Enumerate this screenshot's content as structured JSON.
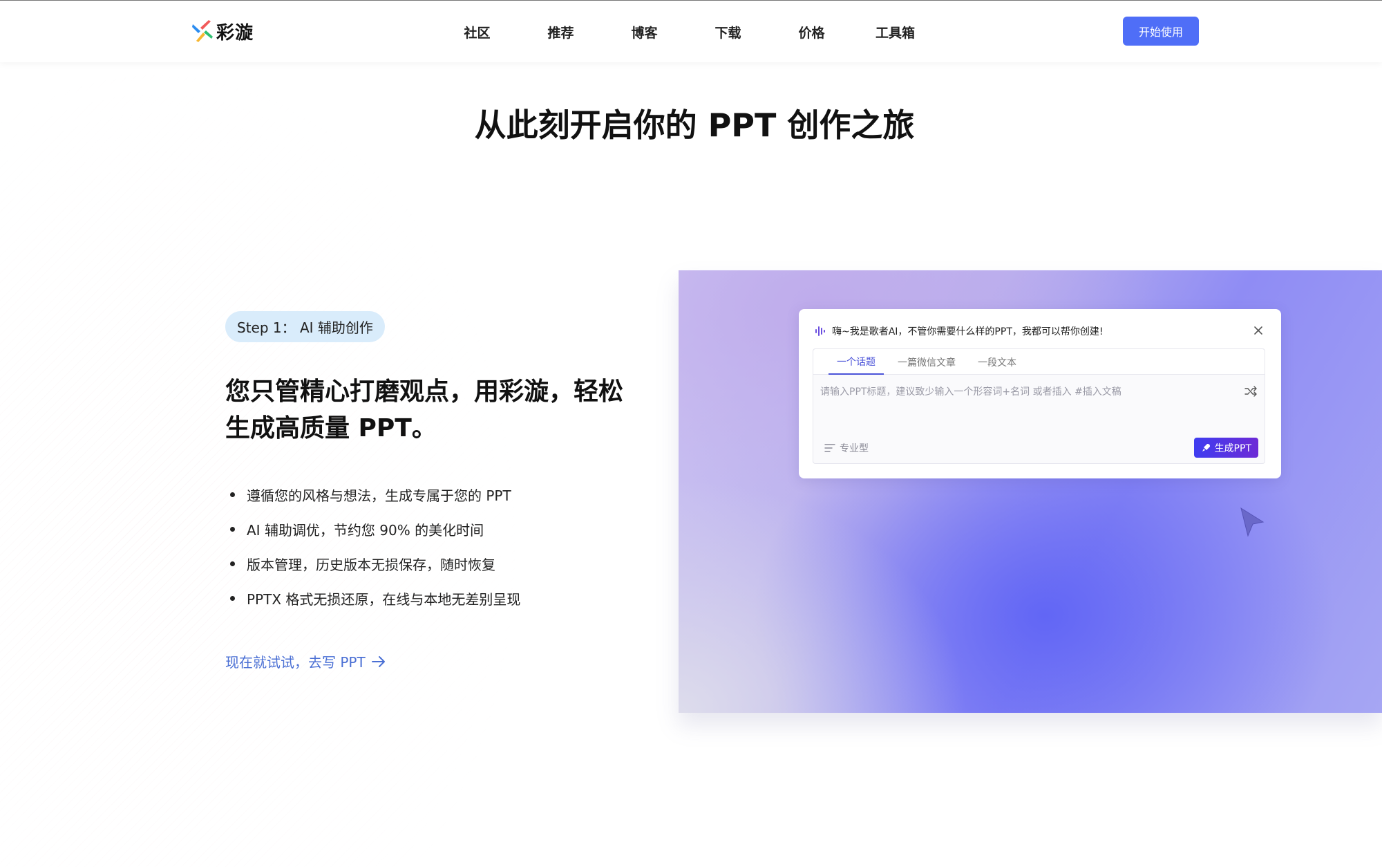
{
  "header": {
    "logo_text": "彩漩",
    "nav": [
      "社区",
      "推荐",
      "博客",
      "下载",
      "价格",
      "工具箱"
    ],
    "start_button": "开始使用"
  },
  "main": {
    "title": "从此刻开启你的 PPT 创作之旅",
    "step_badge": "Step 1： AI 辅助创作",
    "headline_line1": "您只管精心打磨观点，用彩漩，轻松",
    "headline_line2": "生成高质量 PPT。",
    "features": [
      "遵循您的风格与想法，生成专属于您的 PPT",
      "AI 辅助调优，节约您 90% 的美化时间",
      "版本管理，历史版本无损保存，随时恢复",
      "PPTX 格式无损还原，在线与本地无差别呈现"
    ],
    "try_link": "现在就试试，去写 PPT"
  },
  "dialog": {
    "greeting": "嗨~我是歌者AI，不管你需要什么样的PPT，我都可以帮你创建!",
    "tabs": [
      "一个话题",
      "一篇微信文章",
      "一段文本"
    ],
    "active_tab": 0,
    "input_placeholder": "请输入PPT标题，建议致少输入一个形容词+名词 或者插入 #插入文稿",
    "mode_label": "专业型",
    "generate_button": "生成PPT"
  },
  "colors": {
    "primary_blue": "#4f6ef7",
    "link_blue": "#4a6fd4",
    "badge_bg": "#d9ecfb",
    "generate_gradient_start": "#3f3df0",
    "generate_gradient_end": "#6d2ad6"
  },
  "icons": [
    "logo-icon",
    "sound-wave-icon",
    "close-icon",
    "shuffle-icon",
    "list-icon",
    "rocket-icon",
    "arrow-right-icon",
    "cursor-pointer-icon"
  ]
}
